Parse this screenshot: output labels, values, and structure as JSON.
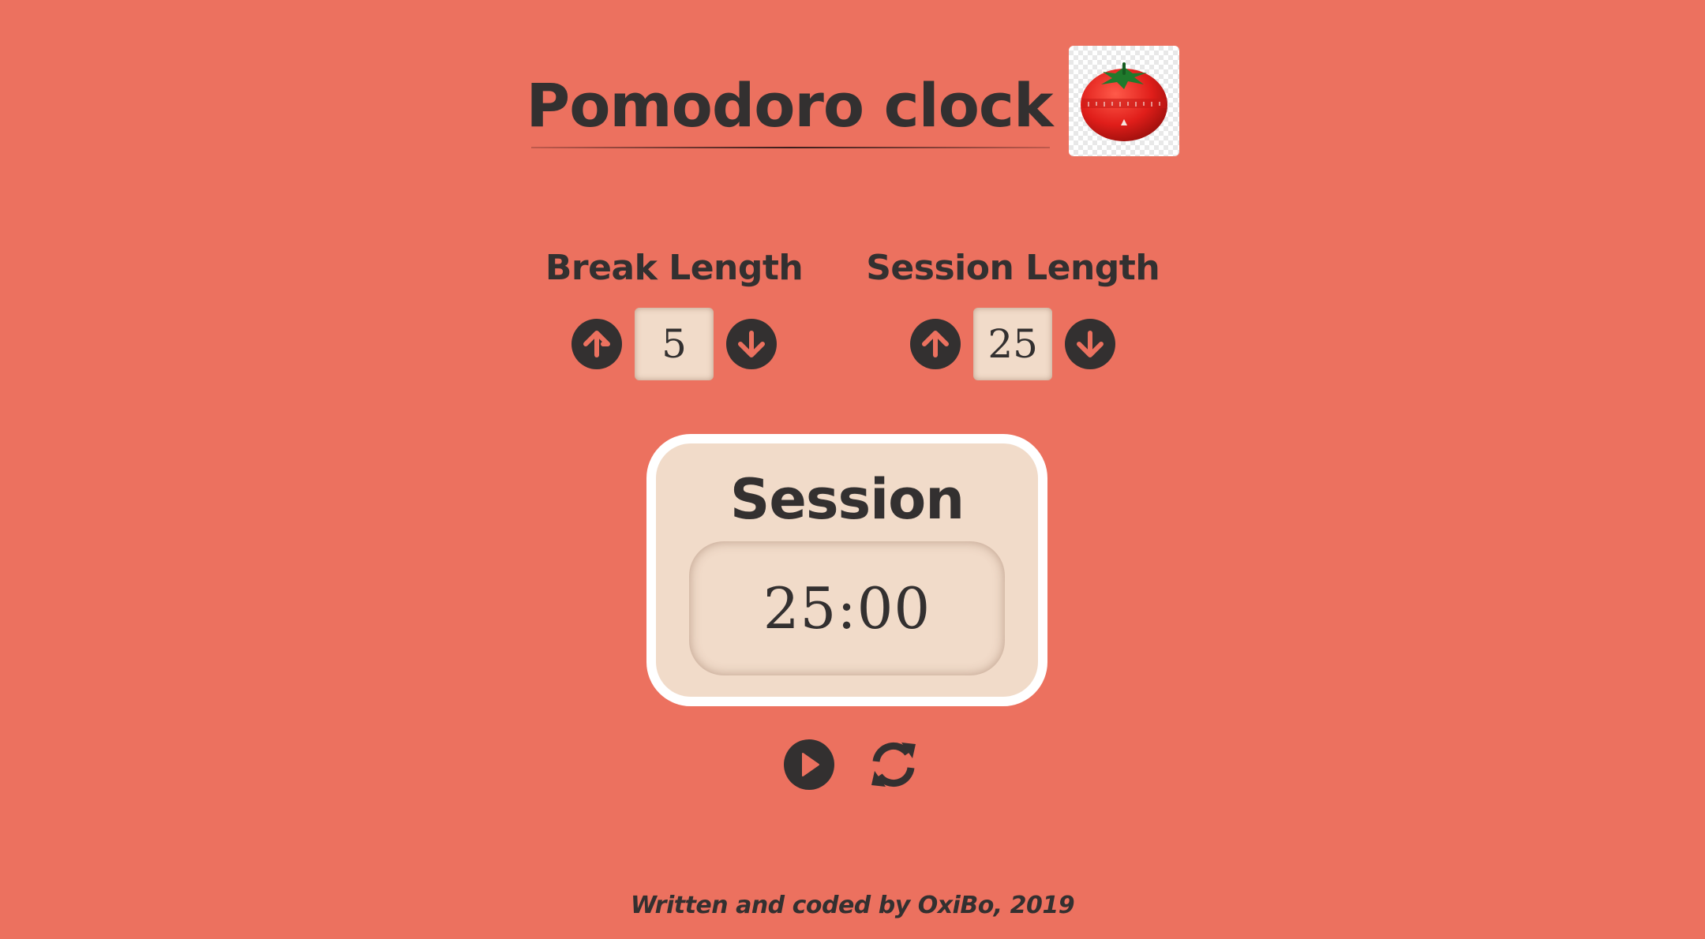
{
  "app": {
    "title": "Pomodoro clock",
    "logo_icon": "tomato-timer-icon"
  },
  "break": {
    "label": "Break Length",
    "value": "5",
    "increment_icon": "arrow-up-circle-icon",
    "decrement_icon": "arrow-down-circle-icon"
  },
  "session": {
    "label": "Session Length",
    "value": "25",
    "increment_icon": "arrow-up-circle-icon",
    "decrement_icon": "arrow-down-circle-icon"
  },
  "timer": {
    "label": "Session",
    "time": "25:00"
  },
  "playback": {
    "play_icon": "play-circle-icon",
    "reset_icon": "refresh-icon"
  },
  "footer": {
    "text": "Written and coded by OxiBo, 2019"
  },
  "colors": {
    "background": "#ec715f",
    "text": "#333030",
    "panel": "#f1dbc9",
    "timer_border": "#ffffff"
  }
}
